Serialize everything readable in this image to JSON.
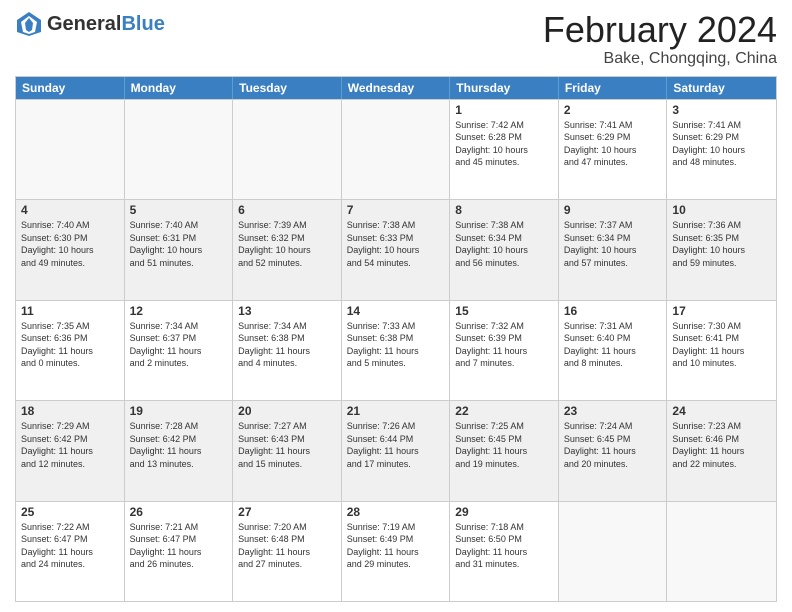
{
  "header": {
    "logo_general": "General",
    "logo_blue": "Blue",
    "title": "February 2024",
    "location": "Bake, Chongqing, China"
  },
  "weekdays": [
    "Sunday",
    "Monday",
    "Tuesday",
    "Wednesday",
    "Thursday",
    "Friday",
    "Saturday"
  ],
  "weeks": [
    [
      {
        "day": "",
        "info": "",
        "empty": true
      },
      {
        "day": "",
        "info": "",
        "empty": true
      },
      {
        "day": "",
        "info": "",
        "empty": true
      },
      {
        "day": "",
        "info": "",
        "empty": true
      },
      {
        "day": "1",
        "info": "Sunrise: 7:42 AM\nSunset: 6:28 PM\nDaylight: 10 hours\nand 45 minutes.",
        "empty": false
      },
      {
        "day": "2",
        "info": "Sunrise: 7:41 AM\nSunset: 6:29 PM\nDaylight: 10 hours\nand 47 minutes.",
        "empty": false
      },
      {
        "day": "3",
        "info": "Sunrise: 7:41 AM\nSunset: 6:29 PM\nDaylight: 10 hours\nand 48 minutes.",
        "empty": false
      }
    ],
    [
      {
        "day": "4",
        "info": "Sunrise: 7:40 AM\nSunset: 6:30 PM\nDaylight: 10 hours\nand 49 minutes.",
        "empty": false
      },
      {
        "day": "5",
        "info": "Sunrise: 7:40 AM\nSunset: 6:31 PM\nDaylight: 10 hours\nand 51 minutes.",
        "empty": false
      },
      {
        "day": "6",
        "info": "Sunrise: 7:39 AM\nSunset: 6:32 PM\nDaylight: 10 hours\nand 52 minutes.",
        "empty": false
      },
      {
        "day": "7",
        "info": "Sunrise: 7:38 AM\nSunset: 6:33 PM\nDaylight: 10 hours\nand 54 minutes.",
        "empty": false
      },
      {
        "day": "8",
        "info": "Sunrise: 7:38 AM\nSunset: 6:34 PM\nDaylight: 10 hours\nand 56 minutes.",
        "empty": false
      },
      {
        "day": "9",
        "info": "Sunrise: 7:37 AM\nSunset: 6:34 PM\nDaylight: 10 hours\nand 57 minutes.",
        "empty": false
      },
      {
        "day": "10",
        "info": "Sunrise: 7:36 AM\nSunset: 6:35 PM\nDaylight: 10 hours\nand 59 minutes.",
        "empty": false
      }
    ],
    [
      {
        "day": "11",
        "info": "Sunrise: 7:35 AM\nSunset: 6:36 PM\nDaylight: 11 hours\nand 0 minutes.",
        "empty": false
      },
      {
        "day": "12",
        "info": "Sunrise: 7:34 AM\nSunset: 6:37 PM\nDaylight: 11 hours\nand 2 minutes.",
        "empty": false
      },
      {
        "day": "13",
        "info": "Sunrise: 7:34 AM\nSunset: 6:38 PM\nDaylight: 11 hours\nand 4 minutes.",
        "empty": false
      },
      {
        "day": "14",
        "info": "Sunrise: 7:33 AM\nSunset: 6:38 PM\nDaylight: 11 hours\nand 5 minutes.",
        "empty": false
      },
      {
        "day": "15",
        "info": "Sunrise: 7:32 AM\nSunset: 6:39 PM\nDaylight: 11 hours\nand 7 minutes.",
        "empty": false
      },
      {
        "day": "16",
        "info": "Sunrise: 7:31 AM\nSunset: 6:40 PM\nDaylight: 11 hours\nand 8 minutes.",
        "empty": false
      },
      {
        "day": "17",
        "info": "Sunrise: 7:30 AM\nSunset: 6:41 PM\nDaylight: 11 hours\nand 10 minutes.",
        "empty": false
      }
    ],
    [
      {
        "day": "18",
        "info": "Sunrise: 7:29 AM\nSunset: 6:42 PM\nDaylight: 11 hours\nand 12 minutes.",
        "empty": false
      },
      {
        "day": "19",
        "info": "Sunrise: 7:28 AM\nSunset: 6:42 PM\nDaylight: 11 hours\nand 13 minutes.",
        "empty": false
      },
      {
        "day": "20",
        "info": "Sunrise: 7:27 AM\nSunset: 6:43 PM\nDaylight: 11 hours\nand 15 minutes.",
        "empty": false
      },
      {
        "day": "21",
        "info": "Sunrise: 7:26 AM\nSunset: 6:44 PM\nDaylight: 11 hours\nand 17 minutes.",
        "empty": false
      },
      {
        "day": "22",
        "info": "Sunrise: 7:25 AM\nSunset: 6:45 PM\nDaylight: 11 hours\nand 19 minutes.",
        "empty": false
      },
      {
        "day": "23",
        "info": "Sunrise: 7:24 AM\nSunset: 6:45 PM\nDaylight: 11 hours\nand 20 minutes.",
        "empty": false
      },
      {
        "day": "24",
        "info": "Sunrise: 7:23 AM\nSunset: 6:46 PM\nDaylight: 11 hours\nand 22 minutes.",
        "empty": false
      }
    ],
    [
      {
        "day": "25",
        "info": "Sunrise: 7:22 AM\nSunset: 6:47 PM\nDaylight: 11 hours\nand 24 minutes.",
        "empty": false
      },
      {
        "day": "26",
        "info": "Sunrise: 7:21 AM\nSunset: 6:47 PM\nDaylight: 11 hours\nand 26 minutes.",
        "empty": false
      },
      {
        "day": "27",
        "info": "Sunrise: 7:20 AM\nSunset: 6:48 PM\nDaylight: 11 hours\nand 27 minutes.",
        "empty": false
      },
      {
        "day": "28",
        "info": "Sunrise: 7:19 AM\nSunset: 6:49 PM\nDaylight: 11 hours\nand 29 minutes.",
        "empty": false
      },
      {
        "day": "29",
        "info": "Sunrise: 7:18 AM\nSunset: 6:50 PM\nDaylight: 11 hours\nand 31 minutes.",
        "empty": false
      },
      {
        "day": "",
        "info": "",
        "empty": true
      },
      {
        "day": "",
        "info": "",
        "empty": true
      }
    ]
  ]
}
